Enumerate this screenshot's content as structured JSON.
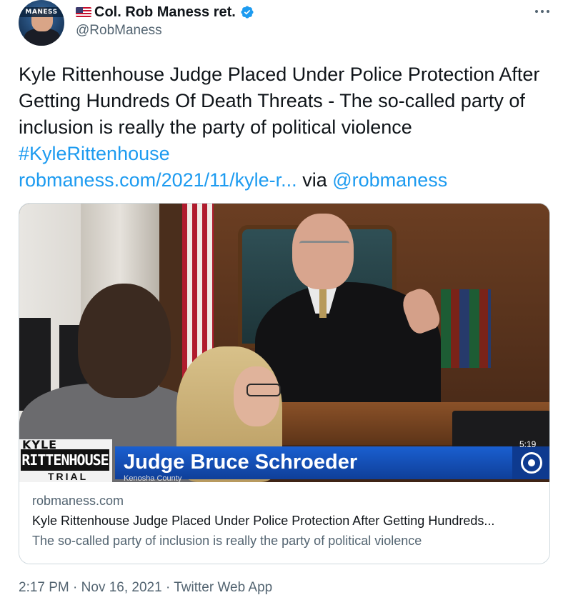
{
  "author": {
    "display_name": "Col. Rob Maness ret.",
    "handle": "@RobManess",
    "avatar_banner_text": "MANESS",
    "flag_icon": "us-flag-icon",
    "verified_icon": "verified-badge-icon",
    "verified_color": "#1d9bf0"
  },
  "tweet": {
    "text_plain": "Kyle Rittenhouse Judge Placed Under Police Protection After Getting Hundreds Of Death Threats - The so-called party of inclusion is really the party of political violence",
    "hashtag": "#KyleRittenhouse",
    "link": "robmaness.com/2021/11/kyle-r...",
    "via": "via",
    "mention": "@robmaness",
    "link_color": "#1d9bf0"
  },
  "card": {
    "image": {
      "chyron_line1": "KYLE",
      "chyron_line2": "RITTENHOUSE",
      "chyron_line3": "TRIAL",
      "chyron_name": "Judge Bruce Schroeder",
      "chyron_sub": "Kenosha County",
      "timestamp": "5:19",
      "network_logo": "cbs-eye-icon"
    },
    "domain": "robmaness.com",
    "title": "Kyle Rittenhouse Judge Placed Under Police Protection After Getting Hundreds...",
    "description": "The so-called party of inclusion is really the party of political violence"
  },
  "meta": {
    "time": "2:17 PM",
    "date": "Nov 16, 2021",
    "source": "Twitter Web App",
    "separator": "·"
  },
  "more_menu_icon": "more-options-icon"
}
